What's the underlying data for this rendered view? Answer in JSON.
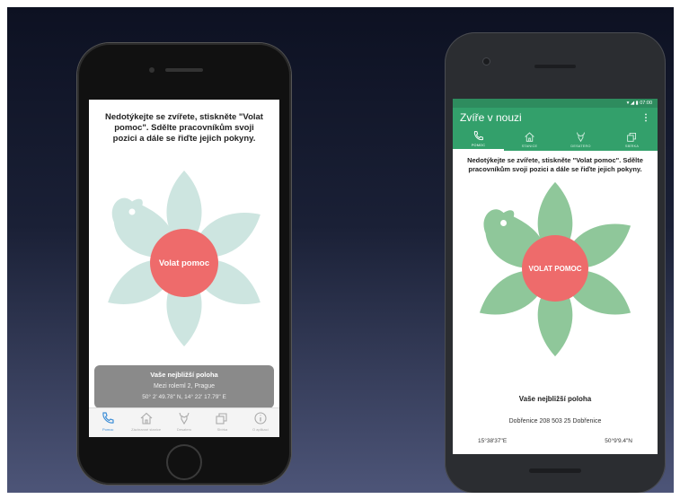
{
  "ios": {
    "instructions": "Nedotýkejte se zvířete, stiskněte \"Volat pomoc\". Sdělte pracovníkům svoji pozici a dále se řiďte jejich pokyny.",
    "call_button": "Volat pomoc",
    "location": {
      "title": "Vaše nejbližší poloha",
      "address": "Mezi roleml 2, Prague",
      "coords": "50° 2' 49.78\" N, 14° 22' 17.79\" E"
    },
    "tabs": [
      {
        "icon": "phone-icon",
        "label": "Pomoc"
      },
      {
        "icon": "home-icon",
        "label": "Záchranné stanice"
      },
      {
        "icon": "deer-icon",
        "label": "Desatero"
      },
      {
        "icon": "cards-icon",
        "label": "Sbírka"
      },
      {
        "icon": "info-icon",
        "label": "O aplikaci"
      }
    ],
    "active_tab": 0
  },
  "android": {
    "status_time": "07:00",
    "title": "Zvíře v nouzi",
    "menu_glyph": "⋮",
    "tabs": [
      {
        "icon": "phone-icon",
        "label": "POMOC"
      },
      {
        "icon": "home-icon",
        "label": "STANICE"
      },
      {
        "icon": "deer-icon",
        "label": "DESATERO"
      },
      {
        "icon": "cards-icon",
        "label": "SBÍRKA"
      }
    ],
    "active_tab": 0,
    "instructions": "Nedotýkejte se zvířete, stiskněte \"Volat pomoc\". Sdělte pracovníkům svoji pozici a dále se řiďte jejich pokyny.",
    "call_button": "VOLAT POMOC",
    "location": {
      "title": "Vaše nejbližší poloha",
      "address": "Dobřenice 208 503 25 Dobřenice",
      "lon": "15°38'37\"E",
      "lat": "50°9'9.4\"N"
    }
  },
  "colors": {
    "accent_green": "#33a06b",
    "petal_ios": "#cde5e0",
    "petal_android": "#8fc79a",
    "call_button": "#ee6b6b"
  }
}
